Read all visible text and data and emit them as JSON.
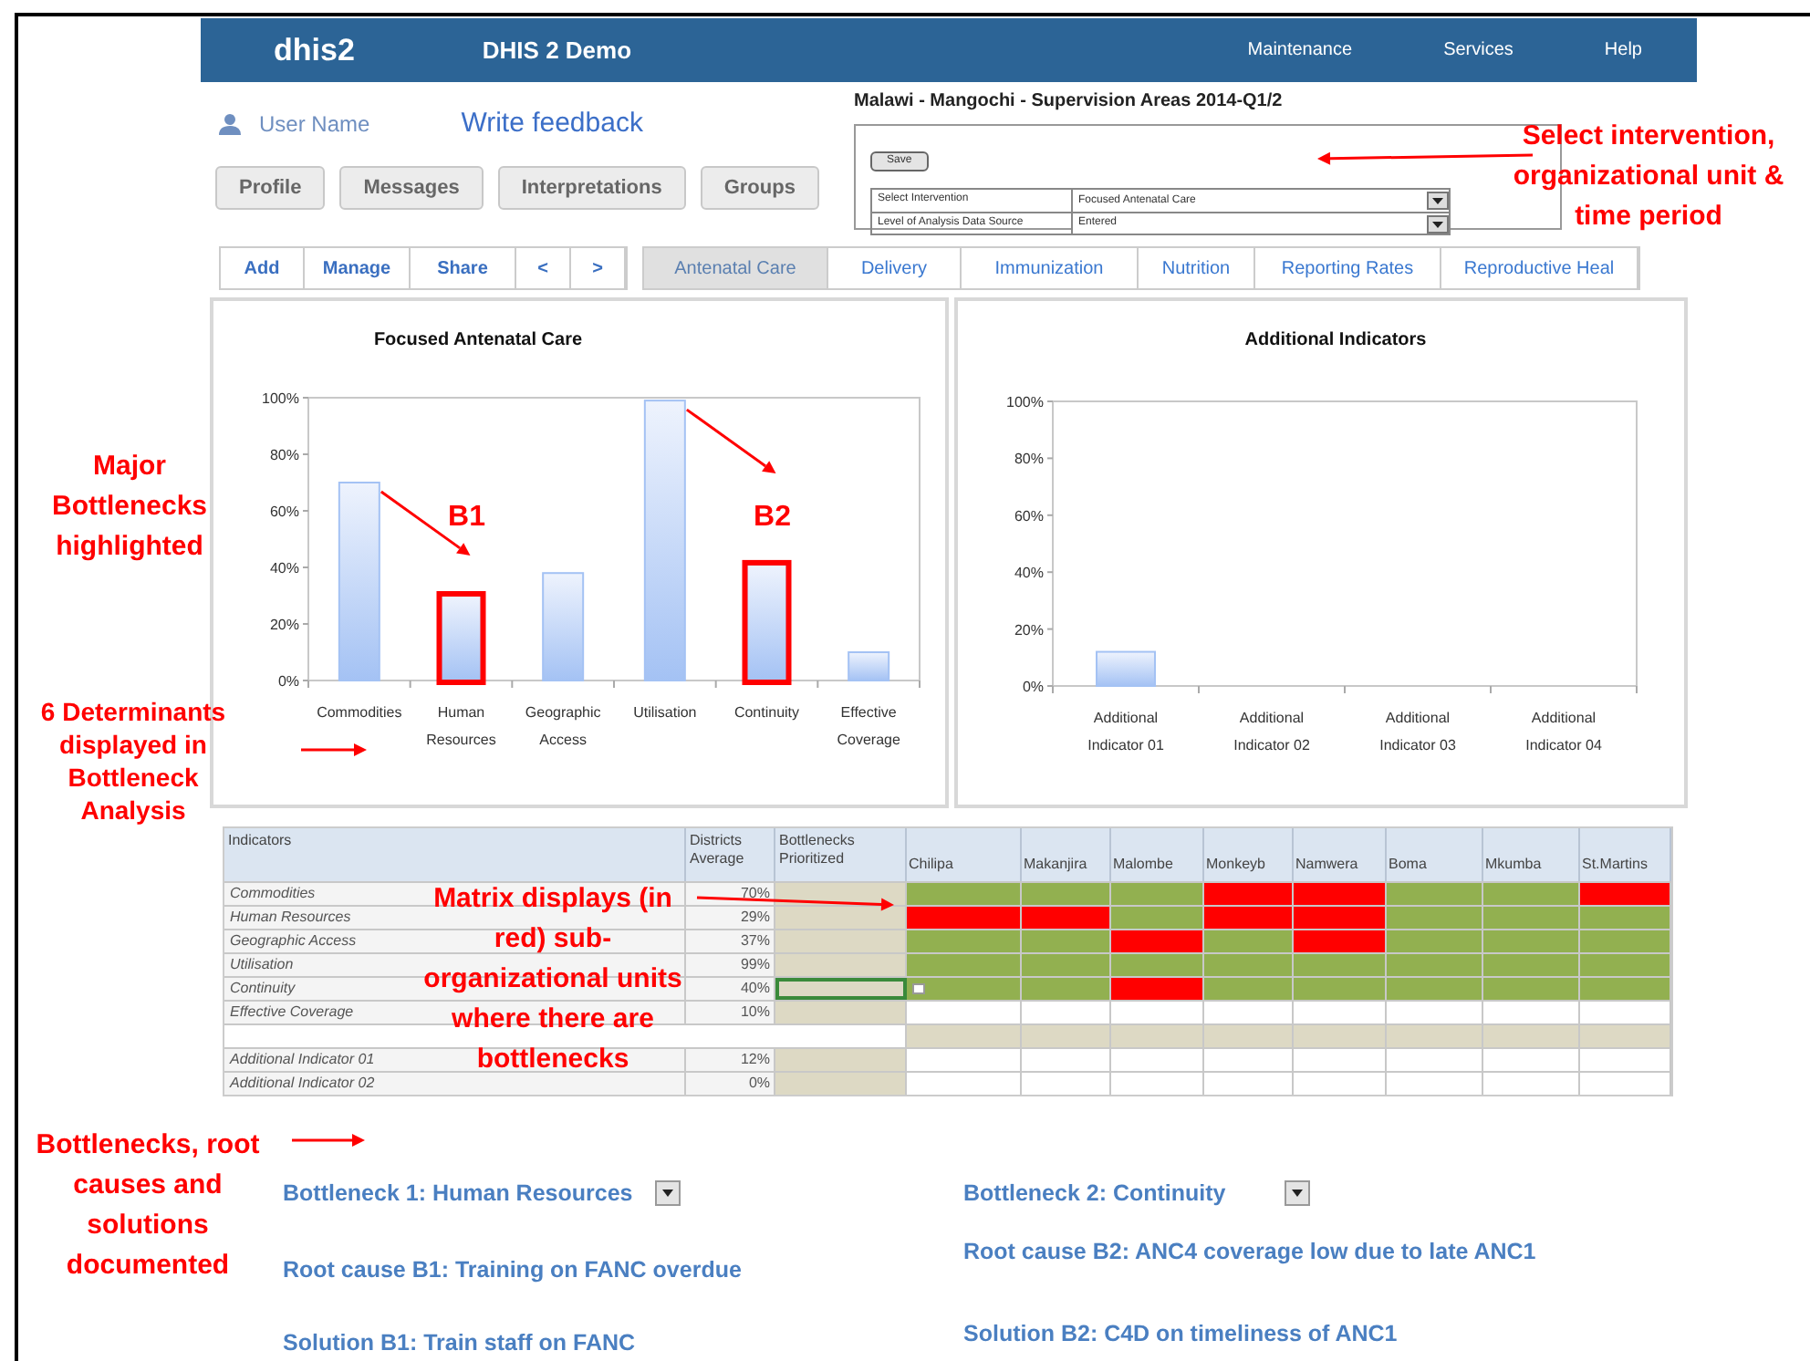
{
  "app_header": {
    "logo": "dhis2",
    "title": "DHIS 2 Demo",
    "nav": [
      "Maintenance",
      "Services",
      "Help"
    ]
  },
  "user": {
    "name": "User Name",
    "feedback_link": "Write feedback"
  },
  "profile_buttons": [
    "Profile",
    "Messages",
    "Interpretations",
    "Groups"
  ],
  "report": {
    "title": "Malawi - Mangochi - Supervision Areas 2014-Q1/2",
    "save_button": "Save",
    "selects": [
      {
        "label": "Select Intervention",
        "value": "Focused Antenatal Care"
      },
      {
        "label": "Level of Analysis Data Source",
        "value": "Entered"
      }
    ]
  },
  "toolbar_buttons": [
    "Add",
    "Manage",
    "Share",
    "<",
    ">"
  ],
  "tabs": [
    {
      "label": "Antenatal Care",
      "selected": true
    },
    {
      "label": "Delivery",
      "selected": false
    },
    {
      "label": "Immunization",
      "selected": false
    },
    {
      "label": "Nutrition",
      "selected": false
    },
    {
      "label": "Reporting Rates",
      "selected": false
    },
    {
      "label": "Reproductive Heal",
      "selected": false
    }
  ],
  "charts": [
    {
      "chart_data": {
        "type": "bar",
        "title": "Focused Antenatal Care",
        "categories": [
          "Commodities",
          "Human Resources",
          "Geographic Access",
          "Utilisation",
          "Continuity",
          "Effective Coverage"
        ],
        "series": [
          {
            "color": "#a4c2f4",
            "values": [
              70,
              30,
              38,
              99,
              41,
              10
            ]
          }
        ],
        "ylim": [
          0,
          100
        ],
        "yticks": [
          {
            "value": 0,
            "label": "0%"
          },
          {
            "value": 20,
            "label": "20%"
          },
          {
            "value": 40,
            "label": "40%"
          },
          {
            "value": 60,
            "label": "60%"
          },
          {
            "value": 80,
            "label": "80%"
          },
          {
            "value": 100,
            "label": "100%"
          }
        ],
        "annotations": [
          "B1",
          "B2"
        ]
      },
      "highlighted": [
        false,
        true,
        false,
        false,
        true,
        false
      ]
    },
    {
      "chart_data": {
        "type": "bar",
        "title": "Additional Indicators",
        "categories": [
          "Additional Indicator 01",
          "Additional Indicator 02",
          "Additional Indicator 03",
          "Additional Indicator 04"
        ],
        "series": [
          {
            "color": "#a4c2f4",
            "values": [
              12,
              null,
              null,
              null
            ]
          }
        ],
        "ylim": [
          0,
          100
        ],
        "yticks": [
          {
            "value": 0,
            "label": "0%"
          },
          {
            "value": 20,
            "label": "20%"
          },
          {
            "value": 40,
            "label": "40%"
          },
          {
            "value": 60,
            "label": "60%"
          },
          {
            "value": 80,
            "label": "80%"
          },
          {
            "value": 100,
            "label": "100%"
          }
        ]
      }
    }
  ],
  "matrix": {
    "columns": [
      "Indicators",
      "Districts Average",
      "Bottlenecks Prioritized"
    ],
    "districts": [
      "Chilipa",
      "Makanjira",
      "Malombe",
      "Monkeyb",
      "Namwera",
      "Boma",
      "Mkumba",
      "St.Martins"
    ],
    "rows": [
      {
        "kind": "indicator",
        "indicator": "Commodities",
        "average": "70%",
        "prioritized_selected": false,
        "cells": [
          {
            "color": "#92b050"
          },
          {
            "color": "#92b050"
          },
          {
            "color": "#92b050"
          },
          {
            "color": "#ff0000"
          },
          {
            "color": "#ff0000"
          },
          {
            "color": "#92b050"
          },
          {
            "color": "#92b050"
          },
          {
            "color": "#ff0000"
          }
        ]
      },
      {
        "kind": "indicator",
        "indicator": "Human Resources",
        "average": "29%",
        "prioritized_selected": false,
        "cells": [
          {
            "color": "#ff0000"
          },
          {
            "color": "#ff0000"
          },
          {
            "color": "#92b050"
          },
          {
            "color": "#ff0000"
          },
          {
            "color": "#ff0000"
          },
          {
            "color": "#92b050"
          },
          {
            "color": "#92b050"
          },
          {
            "color": "#92b050"
          }
        ]
      },
      {
        "kind": "indicator",
        "indicator": "Geographic Access",
        "average": "37%",
        "prioritized_selected": false,
        "cells": [
          {
            "color": "#92b050"
          },
          {
            "color": "#92b050"
          },
          {
            "color": "#ff0000"
          },
          {
            "color": "#92b050"
          },
          {
            "color": "#ff0000"
          },
          {
            "color": "#92b050"
          },
          {
            "color": "#92b050"
          },
          {
            "color": "#92b050"
          }
        ]
      },
      {
        "kind": "indicator",
        "indicator": "Utilisation",
        "average": "99%",
        "prioritized_selected": false,
        "cells": [
          {
            "color": "#92b050"
          },
          {
            "color": "#92b050"
          },
          {
            "color": "#92b050"
          },
          {
            "color": "#92b050"
          },
          {
            "color": "#92b050"
          },
          {
            "color": "#92b050"
          },
          {
            "color": "#92b050"
          },
          {
            "color": "#92b050"
          }
        ]
      },
      {
        "kind": "indicator",
        "indicator": "Continuity",
        "average": "40%",
        "prioritized_selected": true,
        "cells": [
          {
            "color": "#92b050"
          },
          {
            "color": "#92b050"
          },
          {
            "color": "#ff0000"
          },
          {
            "color": "#92b050"
          },
          {
            "color": "#92b050"
          },
          {
            "color": "#92b050"
          },
          {
            "color": "#92b050"
          },
          {
            "color": "#92b050"
          }
        ]
      },
      {
        "kind": "indicator",
        "indicator": "Effective Coverage",
        "average": "10%",
        "prioritized_selected": false,
        "cells": [
          {
            "color": "#ffffff"
          },
          {
            "color": "#ffffff"
          },
          {
            "color": "#ffffff"
          },
          {
            "color": "#ffffff"
          },
          {
            "color": "#ffffff"
          },
          {
            "color": "#ffffff"
          },
          {
            "color": "#ffffff"
          },
          {
            "color": "#ffffff"
          }
        ]
      },
      {
        "kind": "spacer",
        "cells": [
          {
            "color": "#ddd9c4"
          },
          {
            "color": "#ddd9c4"
          },
          {
            "color": "#ddd9c4"
          },
          {
            "color": "#ddd9c4"
          },
          {
            "color": "#ddd9c4"
          },
          {
            "color": "#ddd9c4"
          },
          {
            "color": "#ddd9c4"
          },
          {
            "color": "#ddd9c4"
          }
        ]
      },
      {
        "kind": "indicator",
        "indicator": "Additional Indicator 01",
        "average": "12%",
        "prioritized_selected": false,
        "cells": [
          {
            "color": "#ffffff"
          },
          {
            "color": "#ffffff"
          },
          {
            "color": "#ffffff"
          },
          {
            "color": "#ffffff"
          },
          {
            "color": "#ffffff"
          },
          {
            "color": "#ffffff"
          },
          {
            "color": "#ffffff"
          },
          {
            "color": "#ffffff"
          }
        ]
      },
      {
        "kind": "indicator",
        "indicator": "Additional Indicator 02",
        "average": "0%",
        "prioritized_selected": false,
        "cells": [
          {
            "color": "#ffffff"
          },
          {
            "color": "#ffffff"
          },
          {
            "color": "#ffffff"
          },
          {
            "color": "#ffffff"
          },
          {
            "color": "#ffffff"
          },
          {
            "color": "#ffffff"
          },
          {
            "color": "#ffffff"
          },
          {
            "color": "#ffffff"
          }
        ]
      }
    ]
  },
  "bottlenecks": [
    {
      "bottleneck": "Bottleneck 1:  Human Resources",
      "root_cause": "Root cause B1:  Training on FANC overdue",
      "solution": "Solution B1: Train staff on FANC"
    },
    {
      "bottleneck": "Bottleneck 2: Continuity",
      "root_cause": "Root cause B2: ANC4 coverage low due to late ANC1",
      "solution": "Solution B2: C4D on timeliness of ANC1"
    }
  ],
  "annotations": [
    {
      "text": "Select intervention,\norganizational unit &\ntime period"
    },
    {
      "text": "Major\nBottlenecks\nhighlighted"
    },
    {
      "text": "6 Determinants\ndisplayed in\nBottleneck\nAnalysis"
    },
    {
      "text": "Matrix displays (in\nred) sub-\norganizational units\nwhere there are\nbottlenecks"
    },
    {
      "text": "Bottlenecks, root\ncauses and\nsolutions\ndocumented"
    }
  ]
}
